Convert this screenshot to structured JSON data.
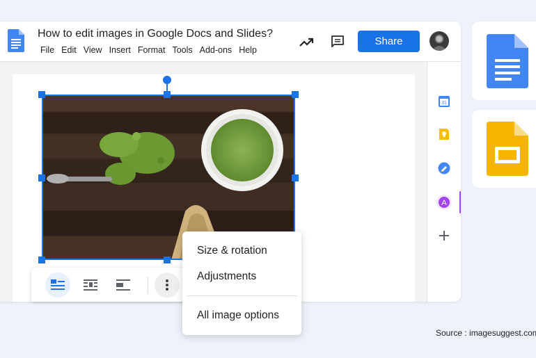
{
  "document": {
    "title": "How to edit images in Google Docs and Slides?",
    "menu": [
      "File",
      "Edit",
      "View",
      "Insert",
      "Format",
      "Tools",
      "Add-ons",
      "Help"
    ]
  },
  "toolbar": {
    "share_label": "Share"
  },
  "context_menu": {
    "items": [
      "Size & rotation",
      "Adjustments",
      "All image options"
    ]
  },
  "side_panel": {
    "calendar_day": "31",
    "avatar_letter": "A"
  },
  "footer": {
    "source": "Source : imagesuggest.com"
  },
  "colors": {
    "accent": "#1a73e8",
    "docs_blue": "#4285f4",
    "slides_yellow": "#f4b400",
    "keep_yellow": "#fbbc04",
    "addon_purple": "#a142f4"
  },
  "icons": [
    "docs-icon",
    "trending-icon",
    "comment-icon",
    "calendar-icon",
    "keep-icon",
    "tasks-icon",
    "addon-icon",
    "add-icon",
    "slides-icon"
  ]
}
